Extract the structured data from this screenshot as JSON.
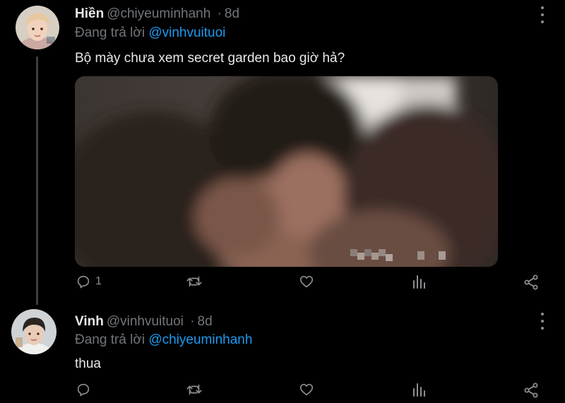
{
  "tweets": [
    {
      "name": "Hiền",
      "handle": "@chiyeuminhanh",
      "separator": "·",
      "time": "8d",
      "reply_prefix": "Đang trả lời",
      "reply_mention": "@vinhvuituoi",
      "text": "Bộ mày chưa xem secret garden bao giờ hả?",
      "media": "blurred-video-frame",
      "reply_count": "1"
    },
    {
      "name": "Vinh",
      "handle": "@vinhvuituoi",
      "separator": "·",
      "time": "8d",
      "reply_prefix": "Đang trả lời",
      "reply_mention": "@chiyeuminhanh",
      "text": "thua",
      "reply_count": ""
    }
  ],
  "icons": {
    "reply": "speech-bubble-icon",
    "retweet": "retweet-icon",
    "like": "heart-icon",
    "analytics": "bar-chart-icon",
    "share": "share-icon",
    "more": "vertical-ellipsis-icon"
  },
  "colors": {
    "background": "#000000",
    "text": "#e7e9ea",
    "muted": "#71767b",
    "link": "#1d9bf0"
  }
}
